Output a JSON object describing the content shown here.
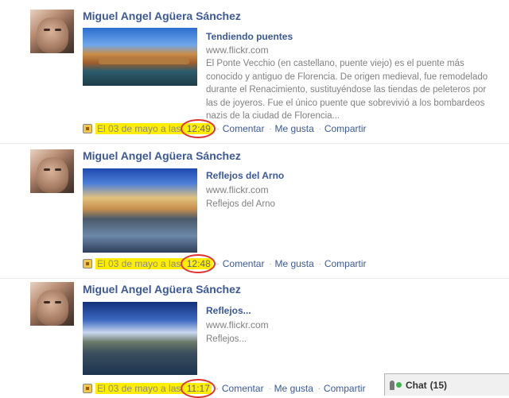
{
  "posts": [
    {
      "author": "Miguel Angel Agüera Sánchez",
      "link_title": "Tendiendo puentes",
      "link_domain": "www.flickr.com",
      "link_description": "El Ponte Vecchio (en castellano, puente viejo) es el puente más conocido y antiguo de Florencia. De origen medieval, fue remodelado durante el Renacimiento, sustituyéndose las tiendas de peleteros por las de joyeros. Fue el único puente que sobrevivió a los bombardeos nazis de la ciudad de Florencia...",
      "time_label": "El 03 de mayo a las ",
      "time_value": "12:49",
      "actions": [
        "Comentar",
        "Me gusta",
        "Compartir"
      ]
    },
    {
      "author": "Miguel Angel Agüera Sánchez",
      "link_title": "Reflejos del Arno",
      "link_domain": "www.flickr.com",
      "link_description": "Reflejos del Arno",
      "time_label": "El 03 de mayo a las ",
      "time_value": "12:48",
      "actions": [
        "Comentar",
        "Me gusta",
        "Compartir"
      ]
    },
    {
      "author": "Miguel Angel Agüera Sánchez",
      "link_title": "Reflejos...",
      "link_domain": "www.flickr.com",
      "link_description": "Reflejos...",
      "time_label": "El 03 de mayo a las ",
      "time_value": "11:17",
      "actions": [
        "Comentar",
        "Me gusta",
        "Compartir"
      ]
    }
  ],
  "chat": {
    "label": "Chat",
    "count": "(15)"
  },
  "colors": {
    "link": "#3b5998",
    "highlight": "#ffee00",
    "annotation_ring": "#e2322d",
    "online": "#3fb24d"
  },
  "icons": [
    "attachment-icon",
    "chat-people-icon",
    "online-status-icon"
  ]
}
